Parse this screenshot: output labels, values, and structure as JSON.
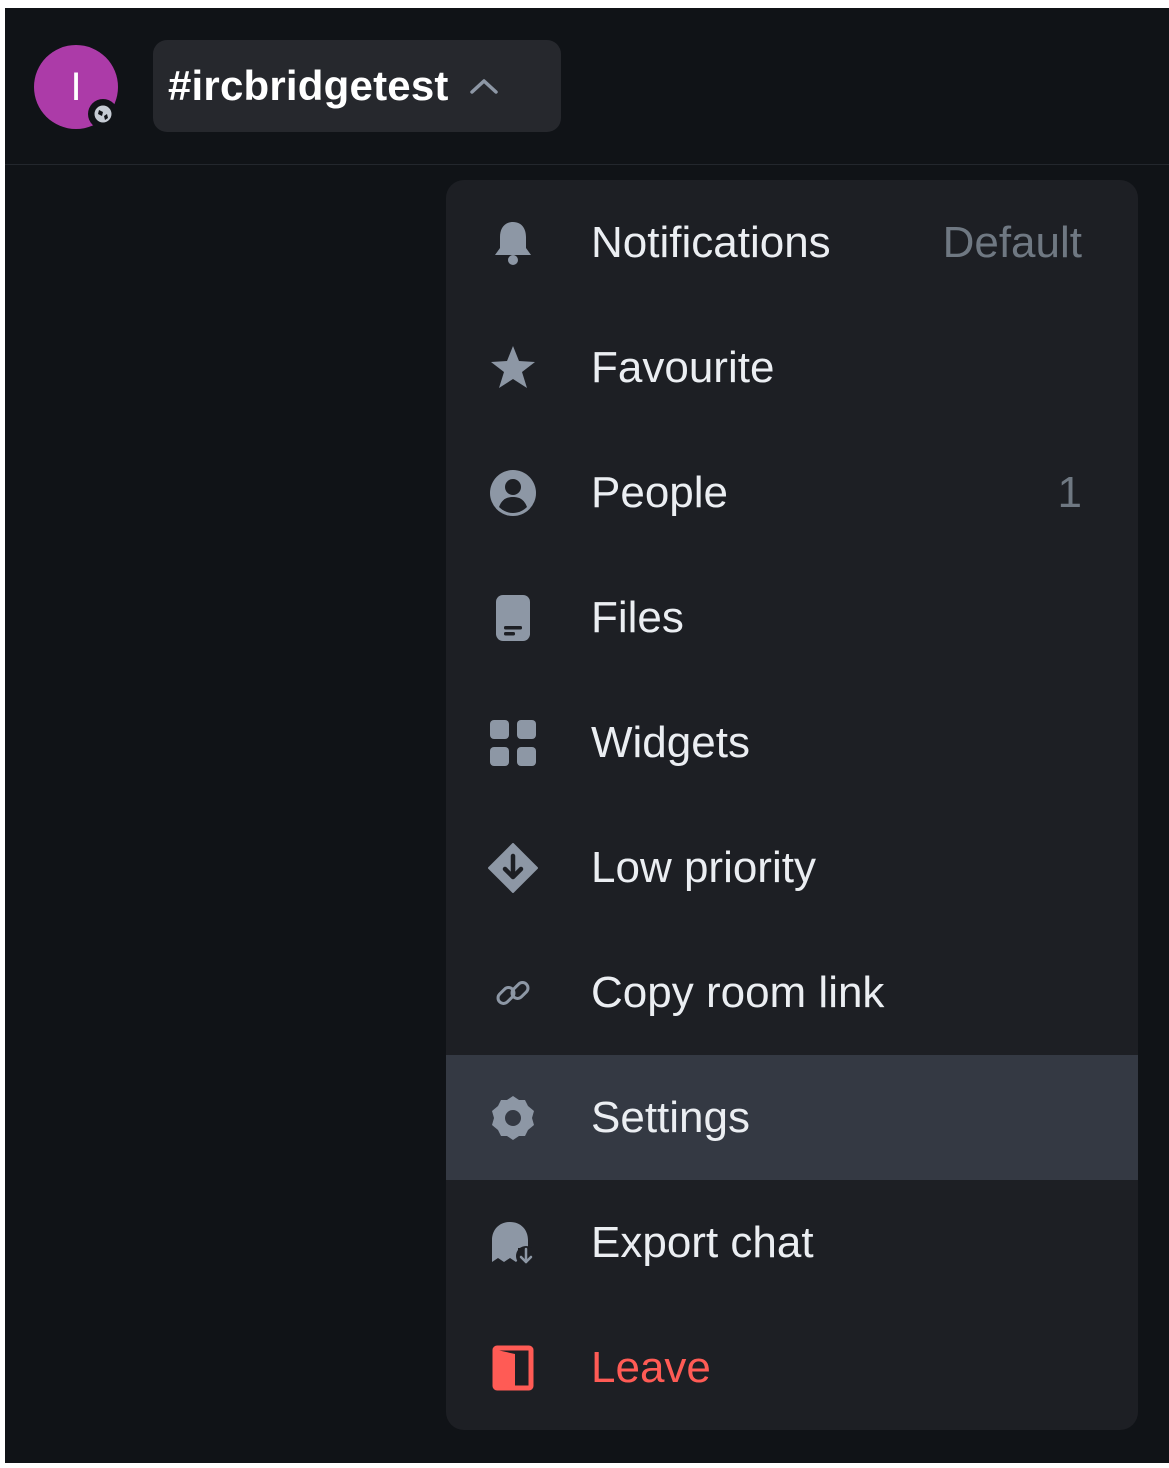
{
  "header": {
    "avatar_letter": "I",
    "room_name": "#ircbridgetest"
  },
  "menu": {
    "items": [
      {
        "label": "Notifications",
        "icon": "bell-icon",
        "trail": "Default"
      },
      {
        "label": "Favourite",
        "icon": "star-icon"
      },
      {
        "label": "People",
        "icon": "user-icon",
        "trail": "1"
      },
      {
        "label": "Files",
        "icon": "file-icon"
      },
      {
        "label": "Widgets",
        "icon": "widgets-icon"
      },
      {
        "label": "Low priority",
        "icon": "low-priority-icon"
      },
      {
        "label": "Copy room link",
        "icon": "link-icon"
      },
      {
        "label": "Settings",
        "icon": "gear-icon",
        "state": "hover"
      },
      {
        "label": "Export chat",
        "icon": "export-chat-icon"
      },
      {
        "label": "Leave",
        "icon": "leave-icon",
        "style": "danger"
      }
    ]
  },
  "colors": {
    "background": "#101317",
    "menu_background": "#1d1f24",
    "hover_background": "#343943",
    "avatar": "#ac3ba8",
    "danger": "#ff5b55",
    "icon": "#8d97a5",
    "trail_text": "#6f7882"
  }
}
